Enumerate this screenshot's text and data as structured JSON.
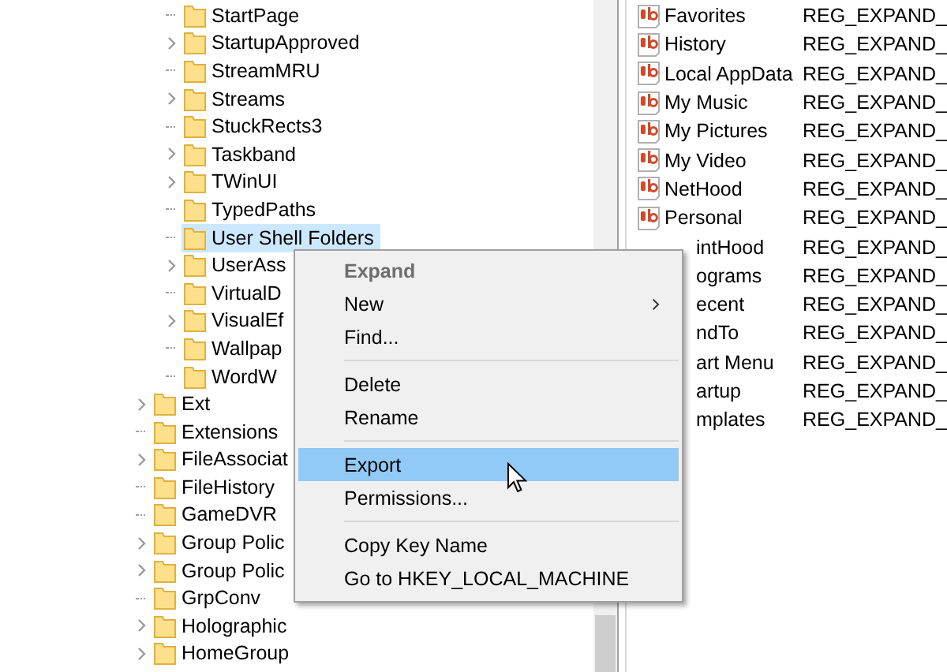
{
  "tree": {
    "items": [
      {
        "children": [
          {
            "label": "StartPage",
            "expandable": false,
            "selected": false
          },
          {
            "label": "StartupApproved",
            "expandable": true,
            "selected": false
          },
          {
            "label": "StreamMRU",
            "expandable": false,
            "selected": false
          },
          {
            "label": "Streams",
            "expandable": true,
            "selected": false
          },
          {
            "label": "StuckRects3",
            "expandable": false,
            "selected": false
          },
          {
            "label": "Taskband",
            "expandable": true,
            "selected": false
          },
          {
            "label": "TWinUI",
            "expandable": true,
            "selected": false
          },
          {
            "label": "TypedPaths",
            "expandable": false,
            "selected": false
          },
          {
            "label": "User Shell Folders",
            "expandable": false,
            "selected": true
          },
          {
            "label": "UserAss",
            "expandable": true,
            "selected": false
          },
          {
            "label": "VirtualD",
            "expandable": false,
            "selected": false
          },
          {
            "label": "VisualEf",
            "expandable": true,
            "selected": false
          },
          {
            "label": "Wallpap",
            "expandable": false,
            "selected": false
          },
          {
            "label": "WordW",
            "expandable": false,
            "selected": false
          }
        ]
      },
      {
        "label": "Ext",
        "expandable": true,
        "selected": false
      },
      {
        "label": "Extensions",
        "expandable": false,
        "selected": false
      },
      {
        "label": "FileAssociat",
        "expandable": true,
        "selected": false
      },
      {
        "label": "FileHistory",
        "expandable": false,
        "selected": false
      },
      {
        "label": "GameDVR",
        "expandable": false,
        "selected": false
      },
      {
        "label": "Group Polic",
        "expandable": true,
        "selected": false
      },
      {
        "label": "Group Polic",
        "expandable": true,
        "selected": false
      },
      {
        "label": "GrpConv",
        "expandable": false,
        "selected": false
      },
      {
        "label": "Holographic",
        "expandable": true,
        "selected": false
      },
      {
        "label": "HomeGroup",
        "expandable": true,
        "selected": false
      }
    ]
  },
  "values": [
    {
      "name": "Favorites",
      "type": "REG_EXPAND_"
    },
    {
      "name": "History",
      "type": "REG_EXPAND_"
    },
    {
      "name": "Local AppData",
      "type": "REG_EXPAND_"
    },
    {
      "name": "My Music",
      "type": "REG_EXPAND_"
    },
    {
      "name": "My Pictures",
      "type": "REG_EXPAND_"
    },
    {
      "name": "My Video",
      "type": "REG_EXPAND_"
    },
    {
      "name": "NetHood",
      "type": "REG_EXPAND_"
    },
    {
      "name": "Personal",
      "type": "REG_EXPAND_"
    },
    {
      "name": "intHood",
      "type": "REG_EXPAND_",
      "covered": true
    },
    {
      "name": "ograms",
      "type": "REG_EXPAND_",
      "covered": true
    },
    {
      "name": "ecent",
      "type": "REG_EXPAND_",
      "covered": true
    },
    {
      "name": "ndTo",
      "type": "REG_EXPAND_",
      "covered": true
    },
    {
      "name": "art Menu",
      "type": "REG_EXPAND_",
      "covered": true
    },
    {
      "name": "artup",
      "type": "REG_EXPAND_",
      "covered": true
    },
    {
      "name": "mplates",
      "type": "REG_EXPAND_",
      "covered": true
    }
  ],
  "context_menu": [
    {
      "kind": "item",
      "label": "Expand",
      "disabled": true,
      "submenu": false,
      "selected": false
    },
    {
      "kind": "item",
      "label": "New",
      "disabled": false,
      "submenu": true,
      "selected": false
    },
    {
      "kind": "item",
      "label": "Find...",
      "disabled": false,
      "submenu": false,
      "selected": false
    },
    {
      "kind": "separator"
    },
    {
      "kind": "item",
      "label": "Delete",
      "disabled": false,
      "submenu": false,
      "selected": false
    },
    {
      "kind": "item",
      "label": "Rename",
      "disabled": false,
      "submenu": false,
      "selected": false
    },
    {
      "kind": "separator"
    },
    {
      "kind": "item",
      "label": "Export",
      "disabled": false,
      "submenu": false,
      "selected": true
    },
    {
      "kind": "item",
      "label": "Permissions...",
      "disabled": false,
      "submenu": false,
      "selected": false
    },
    {
      "kind": "separator"
    },
    {
      "kind": "item",
      "label": "Copy Key Name",
      "disabled": false,
      "submenu": false,
      "selected": false
    },
    {
      "kind": "item",
      "label": "Go to HKEY_LOCAL_MACHINE",
      "disabled": false,
      "submenu": false,
      "selected": false
    }
  ]
}
